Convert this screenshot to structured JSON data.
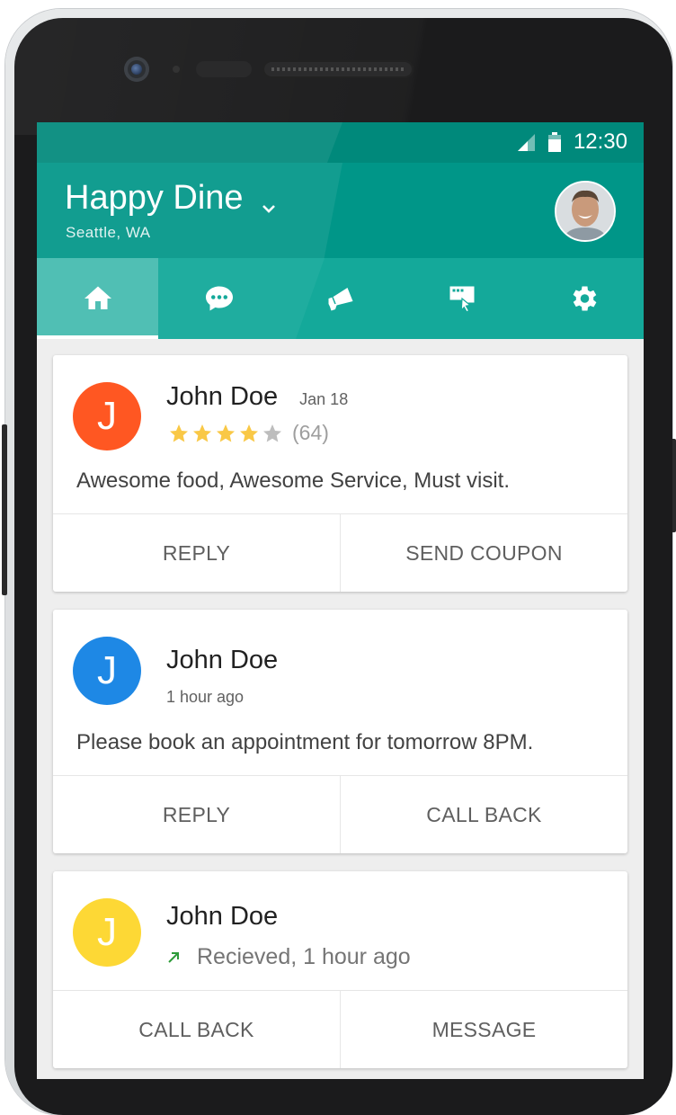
{
  "status_bar": {
    "time": "12:30"
  },
  "app_bar": {
    "title": "Happy Dine",
    "location": "Seattle, WA"
  },
  "tabs": [
    {
      "name": "home",
      "icon": "home-icon",
      "active": true
    },
    {
      "name": "messages",
      "icon": "chat-icon",
      "active": false
    },
    {
      "name": "campaigns",
      "icon": "megaphone-icon",
      "active": false
    },
    {
      "name": "interactions",
      "icon": "touch-icon",
      "active": false
    },
    {
      "name": "settings",
      "icon": "gear-icon",
      "active": false
    }
  ],
  "colors": {
    "primary": "#009688",
    "primary_dark": "#00897b",
    "star": "#f9c846",
    "avatar_orange": "#ff5722",
    "avatar_blue": "#1e88e5",
    "avatar_yellow": "#fdd835",
    "received_arrow": "#2e9c3a"
  },
  "cards": [
    {
      "type": "review",
      "avatar_letter": "J",
      "name": "John Doe",
      "date": "Jan 18",
      "rating": 4,
      "max_rating": 5,
      "review_count": "(64)",
      "message": "Awesome food, Awesome Service, Must visit.",
      "actions": [
        "REPLY",
        "SEND COUPON"
      ]
    },
    {
      "type": "message",
      "avatar_letter": "J",
      "name": "John Doe",
      "time": "1 hour ago",
      "message": "Please book an appointment for tomorrow 8PM.",
      "actions": [
        "REPLY",
        "CALL BACK"
      ]
    },
    {
      "type": "call",
      "avatar_letter": "J",
      "name": "John Doe",
      "call_status": "Recieved, 1 hour ago",
      "actions": [
        "CALL BACK",
        "MESSAGE"
      ]
    }
  ]
}
